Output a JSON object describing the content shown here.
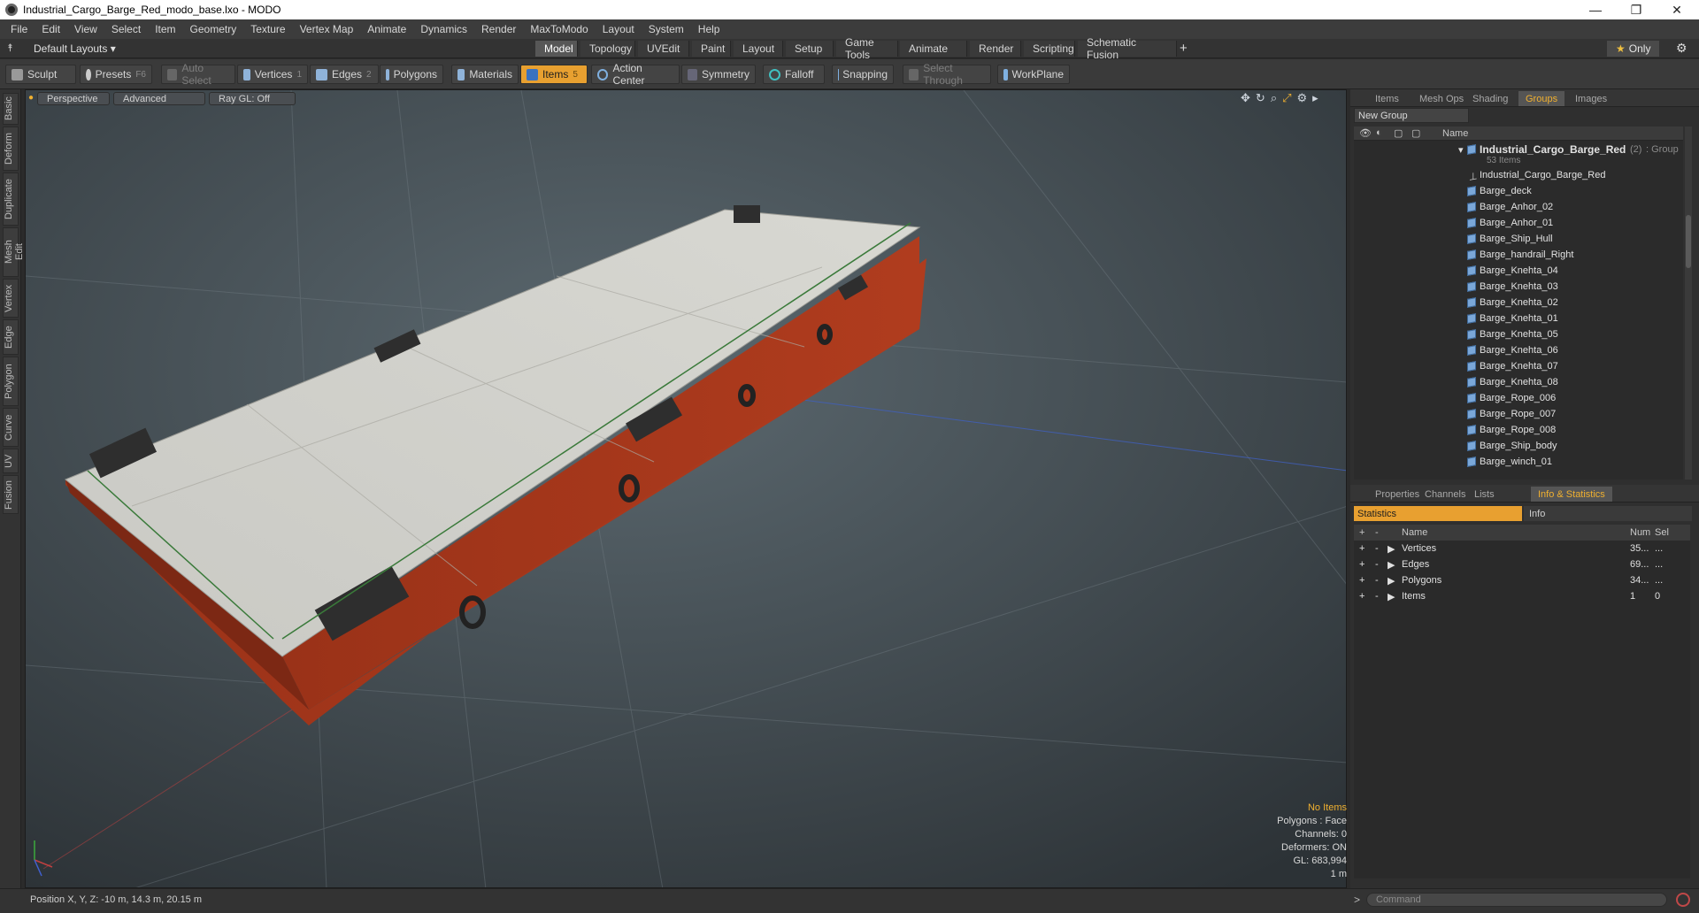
{
  "window": {
    "title": "Industrial_Cargo_Barge_Red_modo_base.lxo - MODO"
  },
  "menu": [
    "File",
    "Edit",
    "View",
    "Select",
    "Item",
    "Geometry",
    "Texture",
    "Vertex Map",
    "Animate",
    "Dynamics",
    "Render",
    "MaxToModo",
    "Layout",
    "System",
    "Help"
  ],
  "layoutbar": {
    "layout_label": "Default Layouts ▾",
    "tabs": [
      "Model",
      "Topology",
      "UVEdit",
      "Paint",
      "Layout",
      "Setup",
      "Game Tools",
      "Animate",
      "Render",
      "Scripting",
      "Schematic Fusion"
    ],
    "active": "Model",
    "only_label": "Only"
  },
  "toolbar": {
    "sculpt": "Sculpt",
    "presets": "Presets",
    "presets_key": "F6",
    "auto_select": "Auto Select",
    "vertices": "Vertices",
    "vertices_key": "1",
    "edges": "Edges",
    "edges_key": "2",
    "polygons": "Polygons",
    "materials": "Materials",
    "items": "Items",
    "items_key": "5",
    "action_center": "Action Center",
    "symmetry": "Symmetry",
    "falloff": "Falloff",
    "snapping": "Snapping",
    "select_through": "Select Through",
    "workplane": "WorkPlane"
  },
  "left_tabs": [
    "Basic",
    "Deform",
    "Duplicate",
    "Mesh Edit",
    "Vertex",
    "Edge",
    "Polygon",
    "Curve",
    "UV",
    "Fusion"
  ],
  "viewport": {
    "view": "Perspective",
    "shading": "Advanced",
    "raygl": "Ray GL: Off"
  },
  "hud": {
    "no_items": "No Items",
    "polygons": "Polygons : Face",
    "channels": "Channels: 0",
    "deformers": "Deformers: ON",
    "gl": "GL: 683,994",
    "scale": "1 m"
  },
  "status": {
    "position": "Position X, Y, Z:  -10 m, 14.3 m, 20.15 m"
  },
  "top_panel": {
    "tabs": [
      "Items",
      "Mesh Ops",
      "Shading",
      "Groups",
      "Images"
    ],
    "active": "Groups",
    "new_group": "New Group",
    "name_col": "Name",
    "group": {
      "name": "Industrial_Cargo_Barge_Red",
      "count": "(2)",
      "type": ": Group",
      "items": "53 Items"
    },
    "items": [
      "Industrial_Cargo_Barge_Red",
      "Barge_deck",
      "Barge_Anhor_02",
      "Barge_Anhor_01",
      "Barge_Ship_Hull",
      "Barge_handrail_Right",
      "Barge_Knehta_04",
      "Barge_Knehta_03",
      "Barge_Knehta_02",
      "Barge_Knehta_01",
      "Barge_Knehta_05",
      "Barge_Knehta_06",
      "Barge_Knehta_07",
      "Barge_Knehta_08",
      "Barge_Rope_006",
      "Barge_Rope_007",
      "Barge_Rope_008",
      "Barge_Ship_body",
      "Barge_winch_01"
    ]
  },
  "bottom_panel": {
    "tabs": [
      "Properties",
      "Channels",
      "Lists",
      "Info & Statistics"
    ],
    "active": "Info & Statistics",
    "statistics": "Statistics",
    "info": "Info",
    "cols": {
      "name": "Name",
      "num": "Num",
      "sel": "Sel"
    },
    "rows": [
      {
        "name": "Vertices",
        "num": "35...",
        "sel": "..."
      },
      {
        "name": "Edges",
        "num": "69...",
        "sel": "..."
      },
      {
        "name": "Polygons",
        "num": "34...",
        "sel": "..."
      },
      {
        "name": "Items",
        "num": "1",
        "sel": "0"
      }
    ]
  },
  "command": {
    "placeholder": "Command"
  }
}
